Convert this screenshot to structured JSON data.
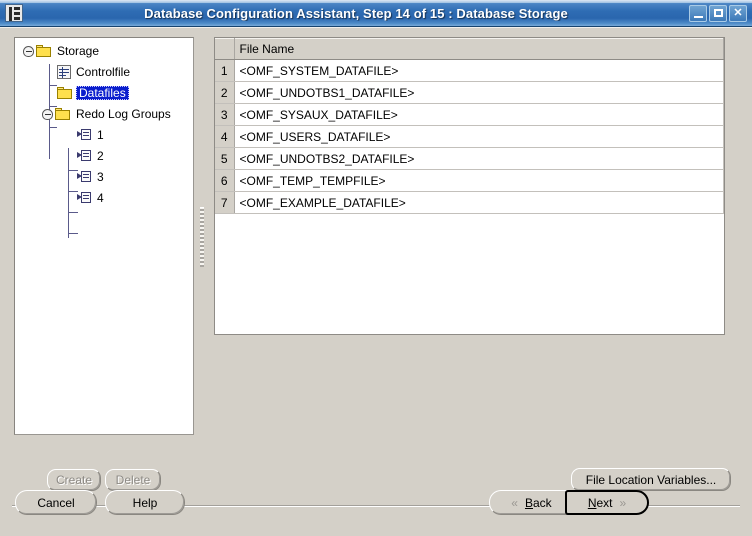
{
  "window": {
    "title": "Database Configuration Assistant, Step 14 of 15 : Database Storage",
    "app_icon": "database-icon",
    "controls": {
      "minimize": "minimize-icon",
      "maximize": "maximize-icon",
      "close": "✕"
    }
  },
  "tree": {
    "nodes": [
      {
        "label": "Storage",
        "icon": "folder-icon",
        "toggle": "collapse-toggle",
        "selected": false,
        "depth": 0
      },
      {
        "label": "Controlfile",
        "icon": "controlfile-icon",
        "toggle": "",
        "selected": false,
        "depth": 1
      },
      {
        "label": "Datafiles",
        "icon": "folder-icon",
        "toggle": "",
        "selected": true,
        "depth": 1
      },
      {
        "label": "Redo Log Groups",
        "icon": "folder-icon",
        "toggle": "collapse-toggle",
        "selected": false,
        "depth": 1
      },
      {
        "label": "1",
        "icon": "logfile-icon",
        "toggle": "",
        "selected": false,
        "depth": 2
      },
      {
        "label": "2",
        "icon": "logfile-icon",
        "toggle": "",
        "selected": false,
        "depth": 2
      },
      {
        "label": "3",
        "icon": "logfile-icon",
        "toggle": "",
        "selected": false,
        "depth": 2
      },
      {
        "label": "4",
        "icon": "logfile-icon",
        "toggle": "",
        "selected": false,
        "depth": 2
      }
    ]
  },
  "table": {
    "columns": [
      "",
      "File Name"
    ],
    "rows": [
      {
        "num": "1",
        "file_name": "<OMF_SYSTEM_DATAFILE>"
      },
      {
        "num": "2",
        "file_name": "<OMF_UNDOTBS1_DATAFILE>"
      },
      {
        "num": "3",
        "file_name": "<OMF_SYSAUX_DATAFILE>"
      },
      {
        "num": "4",
        "file_name": "<OMF_USERS_DATAFILE>"
      },
      {
        "num": "5",
        "file_name": "<OMF_UNDOTBS2_DATAFILE>"
      },
      {
        "num": "6",
        "file_name": "<OMF_TEMP_TEMPFILE>"
      },
      {
        "num": "7",
        "file_name": "<OMF_EXAMPLE_DATAFILE>"
      }
    ]
  },
  "actions": {
    "create": "Create",
    "delete": "Delete",
    "file_location_variables": "File Location Variables...",
    "cancel": "Cancel",
    "help": "Help",
    "back": "Back",
    "back_mnemonic": "B",
    "back_rest": "ack",
    "next": "Next",
    "next_mnemonic": "N",
    "next_rest": "ext",
    "back_chevron": "«",
    "next_chevron": "»"
  },
  "colors": {
    "titlebar": "#2f6db4",
    "selection": "#0a1ecd",
    "face": "#d4d0c8",
    "folder": "#ffe04d"
  }
}
